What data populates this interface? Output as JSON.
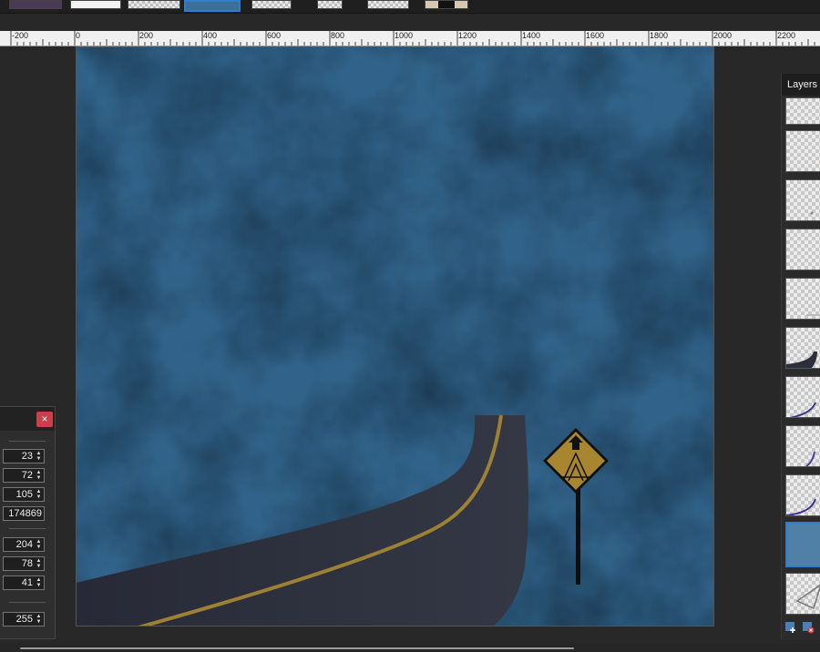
{
  "ruler": {
    "labels": [
      "-200",
      "0",
      "200",
      "400",
      "600",
      "800",
      "1000",
      "1200",
      "1400",
      "1600",
      "1800",
      "2000",
      "2200"
    ]
  },
  "layers_panel": {
    "title": "Layers"
  },
  "color_dialog": {
    "close_symbol": "×",
    "fields": [
      {
        "value": "23"
      },
      {
        "value": "72"
      },
      {
        "value": "105"
      },
      {
        "value": "174869"
      },
      {
        "value": "204"
      },
      {
        "value": "78"
      },
      {
        "value": "41"
      },
      {
        "value": "255"
      }
    ]
  },
  "icons": {
    "add_layer": "add-layer-icon",
    "delete_layer": "delete-layer-icon",
    "close": "close-icon"
  },
  "colors": {
    "sky": "#3f7197",
    "road": "#2c2f3b",
    "road_line": "#b89a3a",
    "sign": "#a8862f",
    "selection": "#2f7dd0",
    "close_button": "#c8404b"
  }
}
